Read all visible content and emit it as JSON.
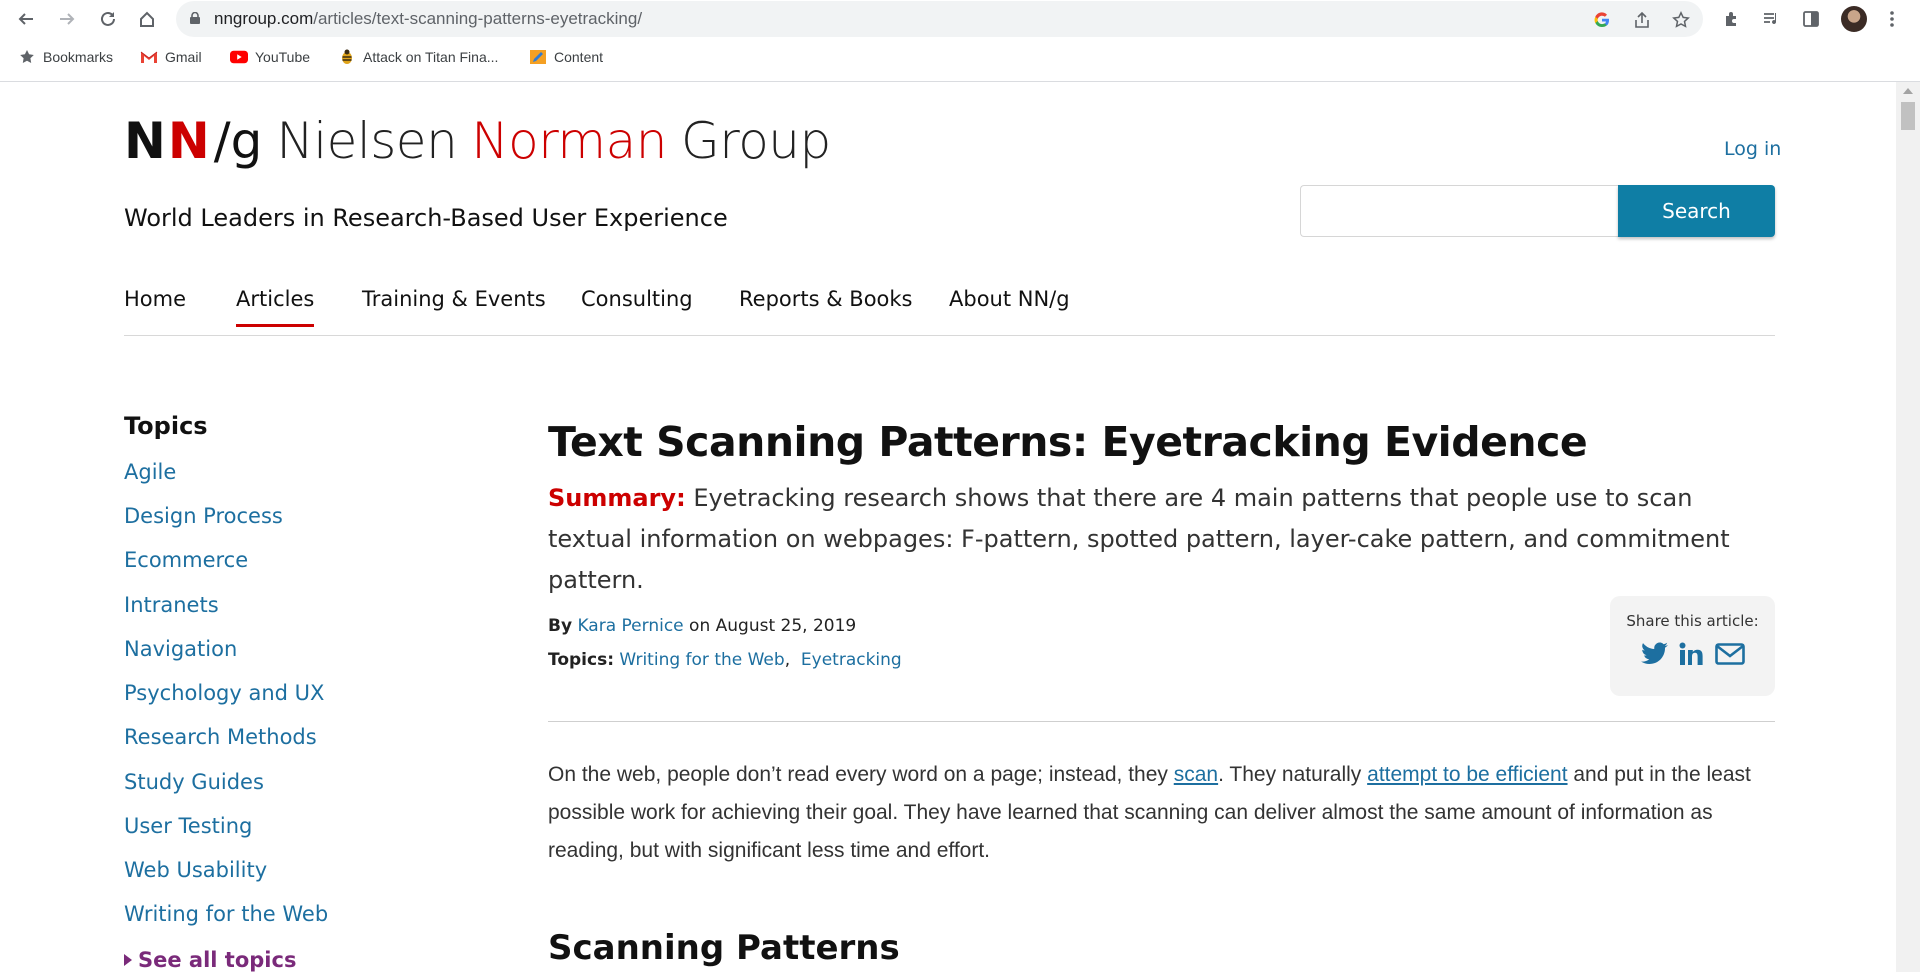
{
  "browser": {
    "url_domain": "nngroup.com",
    "url_path": "/articles/text-scanning-patterns-eyetracking/",
    "bookmarks": [
      {
        "label": "Bookmarks",
        "icon": "star-icon"
      },
      {
        "label": "Gmail",
        "icon": "gmail-icon"
      },
      {
        "label": "YouTube",
        "icon": "youtube-icon"
      },
      {
        "label": "Attack on Titan Fina...",
        "icon": "bee-icon"
      },
      {
        "label": "Content",
        "icon": "pencil-icon"
      }
    ]
  },
  "header": {
    "logo_nn_1": "N",
    "logo_nn_2": "N",
    "logo_g": "/g",
    "logo_word_1": "Nielsen",
    "logo_word_2": "Norman",
    "logo_word_3": "Group",
    "tagline": "World Leaders in Research-Based User Experience",
    "login": "Log in",
    "search_button": "Search",
    "search_placeholder": ""
  },
  "nav": {
    "items": [
      "Home",
      "Articles",
      "Training & Events",
      "Consulting",
      "Reports & Books",
      "About NN/g"
    ],
    "active": "Articles"
  },
  "sidebar": {
    "heading": "Topics",
    "topics": [
      "Agile",
      "Design Process",
      "Ecommerce",
      "Intranets",
      "Navigation",
      "Psychology and UX",
      "Research Methods",
      "Study Guides",
      "User Testing",
      "Web Usability",
      "Writing for the Web"
    ],
    "see_all": "See all topics"
  },
  "article": {
    "title": "Text Scanning Patterns: Eyetracking Evidence",
    "summary_label": "Summary:",
    "summary_text": "Eyetracking research shows that there are 4 main patterns that people use to scan textual information on webpages: F-pattern, spotted pattern, layer-cake pattern, and commitment pattern.",
    "by_label": "By",
    "author": "Kara Pernice",
    "date_text": "on August 25, 2019",
    "topics_label": "Topics:",
    "topic_1": "Writing for the Web",
    "topic_sep": ",",
    "topic_2": "Eyetracking",
    "share_label": "Share this article:",
    "body_1": "On the web, people  don’t read every word on a page; instead, they ",
    "body_link_1": "scan",
    "body_2": ". They naturally ",
    "body_link_2": "attempt to be efficient",
    "body_3": " and put in the least possible work for achieving their goal. They have learned that scanning can deliver almost the same amount of information as reading, but with significant less time and effort.",
    "section_heading": "Scanning Patterns"
  },
  "colors": {
    "brand_red": "#cc0000",
    "link_blue": "#1d6fa0",
    "search_button": "#0f7ea5",
    "see_all_purple": "#7a2a7a"
  }
}
